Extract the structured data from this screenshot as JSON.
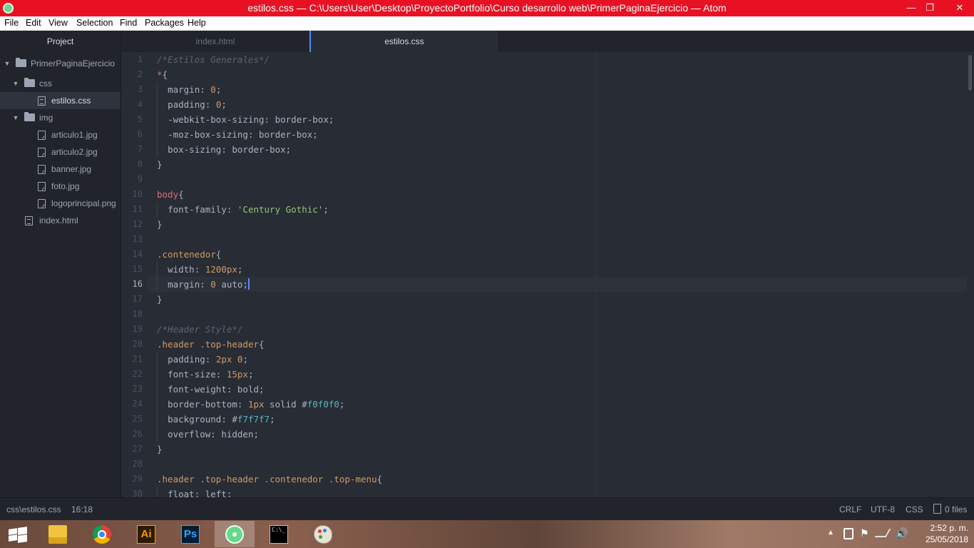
{
  "window": {
    "title": "estilos.css — C:\\Users\\User\\Desktop\\ProyectoPortfolio\\Curso desarrollo web\\PrimerPaginaEjercicio — Atom",
    "minimize_label": "—",
    "maximize_label": "❐",
    "close_label": "✕",
    "accent_color": "#e81123"
  },
  "menu": [
    "File",
    "Edit",
    "View",
    "Selection",
    "Find",
    "Packages",
    "Help"
  ],
  "tree": {
    "header": "Project",
    "items": [
      {
        "label": "PrimerPaginaEjercicio",
        "icon": "folder-icon",
        "expanded": true
      },
      {
        "label": "css",
        "icon": "folder-icon",
        "expanded": true
      },
      {
        "label": "estilos.css",
        "icon": "file-icon",
        "selected": true
      },
      {
        "label": "img",
        "icon": "folder-icon",
        "expanded": true
      },
      {
        "label": "articulo1.jpg",
        "icon": "image-file-icon"
      },
      {
        "label": "articulo2.jpg",
        "icon": "image-file-icon"
      },
      {
        "label": "banner.jpg",
        "icon": "image-file-icon"
      },
      {
        "label": "foto.jpg",
        "icon": "image-file-icon"
      },
      {
        "label": "logoprincipal.png",
        "icon": "image-file-icon"
      },
      {
        "label": "index.html",
        "icon": "file-icon"
      }
    ]
  },
  "tabs": [
    {
      "label": "index.html",
      "active": false
    },
    {
      "label": "estilos.css",
      "active": true
    }
  ],
  "editor": {
    "current_line": 16,
    "line_numbers": [
      "1",
      "2",
      "3",
      "4",
      "5",
      "6",
      "7",
      "8",
      "9",
      "10",
      "11",
      "12",
      "13",
      "14",
      "15",
      "16",
      "17",
      "18",
      "19",
      "20",
      "21",
      "22",
      "23",
      "24",
      "25",
      "26",
      "27",
      "28",
      "29",
      "30"
    ],
    "code": [
      "/*Estilos Generales*/",
      "*{",
      "  margin: 0;",
      "  padding: 0;",
      "  -webkit-box-sizing: border-box;",
      "  -moz-box-sizing: border-box;",
      "  box-sizing: border-box;",
      "}",
      "",
      "body{",
      "  font-family: 'Century Gothic';",
      "}",
      "",
      ".contenedor{",
      "  width: 1200px;",
      "  margin: 0 auto;",
      "}",
      "",
      "/*Header Style*/",
      ".header .top-header{",
      "  padding: 2px 0;",
      "  font-size: 15px;",
      "  font-weight: bold;",
      "  border-bottom: 1px solid #f0f0f0;",
      "  background: #f7f7f7;",
      "  overflow: hidden;",
      "}",
      "",
      ".header .top-header .contenedor .top-menu{",
      "  float: left;"
    ]
  },
  "status": {
    "file_path": "css\\estilos.css",
    "cursor_position": "16:18",
    "line_ending": "CRLF",
    "encoding": "UTF-8",
    "grammar": "CSS",
    "git_files": "0 files"
  },
  "taskbar": {
    "apps": [
      {
        "name": "file-explorer-icon",
        "active": false
      },
      {
        "name": "chrome-icon",
        "active": false
      },
      {
        "name": "illustrator-icon",
        "label": "Ai",
        "active": false
      },
      {
        "name": "photoshop-icon",
        "label": "Ps",
        "active": false
      },
      {
        "name": "atom-icon",
        "active": true
      },
      {
        "name": "cmd-icon",
        "label": "C:\\_",
        "active": false
      },
      {
        "name": "paint-icon",
        "active": false
      }
    ],
    "time": "2:52 p. m.",
    "date": "25/05/2018"
  }
}
